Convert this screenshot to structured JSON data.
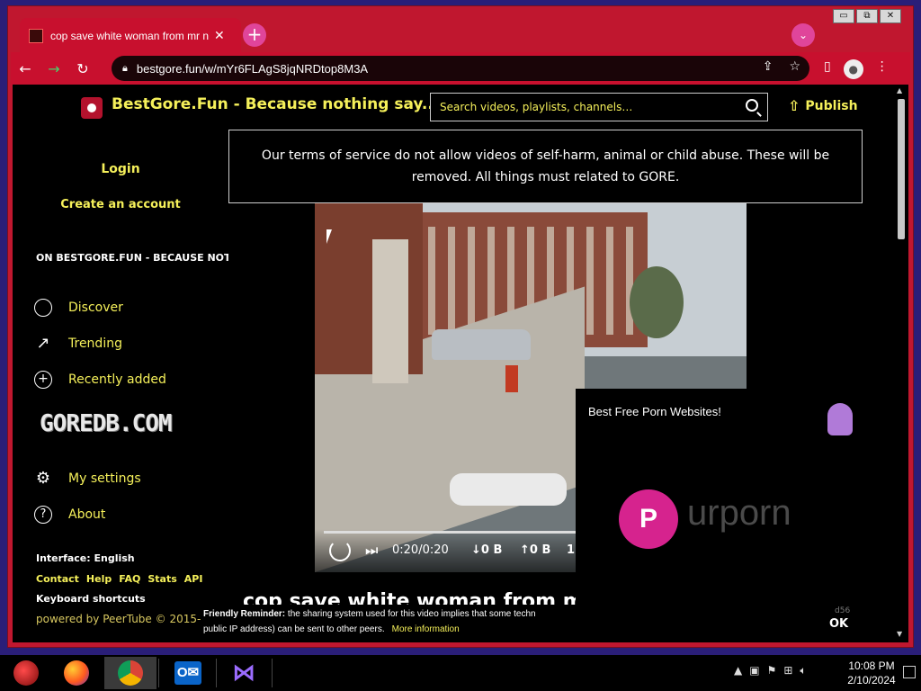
{
  "window": {
    "minimize": "▭",
    "restore": "⧉",
    "close": "✕"
  },
  "tab": {
    "title": "cop save white woman from mr n",
    "close": "✕"
  },
  "new_tab": "+",
  "address_bar": {
    "url": "bestgore.fun/w/mYr6FLAgS8jqNRDtop8M3A"
  },
  "site": {
    "title": "BestGore.Fun - Because nothing say...",
    "search_placeholder": "Search videos, playlists, channels…",
    "publish": "Publish"
  },
  "sidebar": {
    "login": "Login",
    "create_account": "Create an account",
    "section_heading": "ON BESTGORE.FUN - BECAUSE NOTHING",
    "items": [
      {
        "label": "Discover",
        "icon": "globe-icon"
      },
      {
        "label": "Trending",
        "icon": "trending-icon"
      },
      {
        "label": "Recently added",
        "icon": "plus-circle-icon"
      }
    ],
    "banner": "GOREDB.COM",
    "settings_items": [
      {
        "label": "My settings",
        "icon": "gear-icon"
      },
      {
        "label": "About",
        "icon": "help-icon"
      }
    ],
    "interface": "Interface: English",
    "footer_links": [
      "Contact",
      "Help",
      "FAQ",
      "Stats",
      "API"
    ],
    "keyboard": "Keyboard shortcuts",
    "powered_by_prefix": "powered by ",
    "powered_by_name": "PeerTube",
    "powered_by_suffix": " © 2015-"
  },
  "tos_notice": "Our terms of service do not allow videos of self-harm, animal or child abuse. These will be removed. All things must related to GORE.",
  "video": {
    "time": "0:20/0:20",
    "download": "↓0 B",
    "upload": "↑0 B",
    "peers": "1",
    "title": "cop save white woman from mr n"
  },
  "ad": {
    "title": "Best Free Porn Websites!",
    "logo_letter": "P",
    "brand": "urporn",
    "code": "d56",
    "ok": "OK"
  },
  "reminder": {
    "label": "Friendly Reminder:",
    "text_line1": " the sharing system used for this video implies that some techn",
    "text_line2": "public IP address) can be sent to other peers.",
    "more": "More information"
  },
  "taskbar": {
    "time": "10:08 PM",
    "date": "2/10/2024"
  },
  "colors": {
    "accent_yellow": "#f5f05a",
    "chrome_red": "#c8102e",
    "background": "#000000"
  }
}
